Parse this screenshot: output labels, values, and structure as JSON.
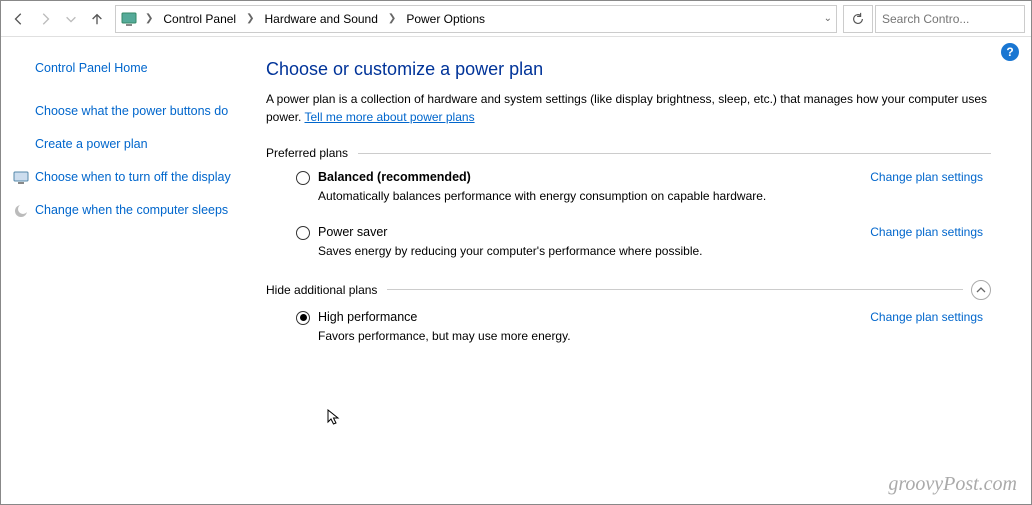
{
  "nav": {
    "breadcrumb": [
      "Control Panel",
      "Hardware and Sound",
      "Power Options"
    ]
  },
  "search": {
    "placeholder": "Search Contro..."
  },
  "sidebar": {
    "home": "Control Panel Home",
    "links": [
      {
        "label": "Choose what the power buttons do",
        "icon": null
      },
      {
        "label": "Create a power plan",
        "icon": null
      },
      {
        "label": "Choose when to turn off the display",
        "icon": "monitor"
      },
      {
        "label": "Change when the computer sleeps",
        "icon": "moon"
      }
    ]
  },
  "main": {
    "title": "Choose or customize a power plan",
    "desc_pre": "A power plan is a collection of hardware and system settings (like display brightness, sleep, etc.) that manages how your computer uses power. ",
    "desc_link": "Tell me more about power plans",
    "section1": "Preferred plans",
    "section2": "Hide additional plans",
    "change_link": "Change plan settings",
    "plans_pref": [
      {
        "name": "Balanced (recommended)",
        "bold": true,
        "desc": "Automatically balances performance with energy consumption on capable hardware.",
        "checked": false
      },
      {
        "name": "Power saver",
        "bold": false,
        "desc": "Saves energy by reducing your computer's performance where possible.",
        "checked": false
      }
    ],
    "plans_add": [
      {
        "name": "High performance",
        "bold": false,
        "desc": "Favors performance, but may use more energy.",
        "checked": true
      }
    ]
  },
  "watermark": "groovyPost.com"
}
